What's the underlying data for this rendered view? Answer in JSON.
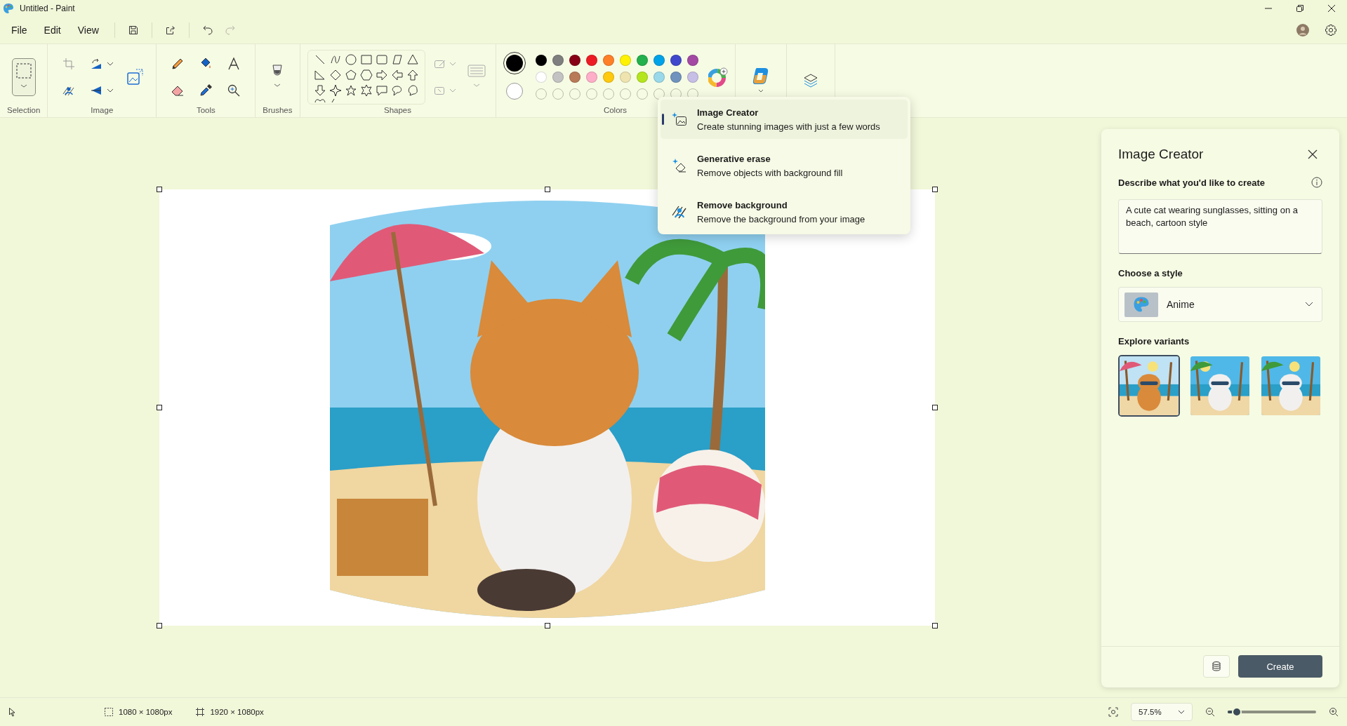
{
  "window": {
    "title": "Untitled - Paint"
  },
  "menu": [
    {
      "label": "File"
    },
    {
      "label": "Edit"
    },
    {
      "label": "View"
    }
  ],
  "redo_disabled": true,
  "ribbon_groups": [
    {
      "label": "Selection"
    },
    {
      "label": "Image"
    },
    {
      "label": "Tools"
    },
    {
      "label": "Brushes"
    },
    {
      "label": "Shapes"
    },
    {
      "label": "Colors"
    }
  ],
  "palette": [
    {
      "color": "#000000",
      "selected": false
    },
    {
      "color": "#7f7f7f",
      "selected": false
    },
    {
      "color": "#880015",
      "selected": false
    },
    {
      "color": "#ed1c24",
      "selected": false
    },
    {
      "color": "#ff7f27",
      "selected": false
    },
    {
      "color": "#fff200",
      "selected": false
    },
    {
      "color": "#22b14c",
      "selected": false
    },
    {
      "color": "#00a2e8",
      "selected": false
    },
    {
      "color": "#3f48cc",
      "selected": false
    },
    {
      "color": "#a349a4",
      "selected": false
    },
    {
      "color": "#ffffff",
      "selected": false
    },
    {
      "color": "#c3c3c3",
      "selected": false
    },
    {
      "color": "#b97a57",
      "selected": false
    },
    {
      "color": "#ffaec9",
      "selected": false
    },
    {
      "color": "#ffc90e",
      "selected": false
    },
    {
      "color": "#efe4b0",
      "selected": false
    },
    {
      "color": "#b5e61d",
      "selected": false
    },
    {
      "color": "#99d9ea",
      "selected": false
    },
    {
      "color": "#7092be",
      "selected": false
    },
    {
      "color": "#c8bfe7",
      "selected": false
    }
  ],
  "current_colors": [
    {
      "color": "#000000",
      "selected": true
    },
    {
      "color": "#ffffff",
      "selected": false
    }
  ],
  "copilot_menu": [
    {
      "kind": "creator",
      "title": "Image Creator",
      "description": "Create stunning images with just a few words",
      "selected": true
    },
    {
      "kind": "erase",
      "title": "Generative erase",
      "description": "Remove objects with background fill",
      "selected": false
    },
    {
      "kind": "background",
      "title": "Remove background",
      "description": "Remove the background from your image",
      "selected": false
    }
  ],
  "panel": {
    "title": "Image Creator",
    "prompt_label": "Describe what you'd like to create",
    "prompt": "A cute cat wearing sunglasses, sitting on a beach, cartoon style",
    "style_label": "Choose a style",
    "style": "Anime",
    "variants_label": "Explore variants",
    "variants": [
      {
        "kind": "picture",
        "selected": true
      },
      {
        "kind": "picture",
        "selected": false
      },
      {
        "kind": "picture",
        "selected": false
      }
    ],
    "create_button": "Create"
  },
  "status_bar": {
    "selection_size": "1080 × 1080px",
    "canvas_size": "1920 × 1080px",
    "zoom": "57.5%",
    "zoom_level": {
      "level": 0.1
    }
  }
}
